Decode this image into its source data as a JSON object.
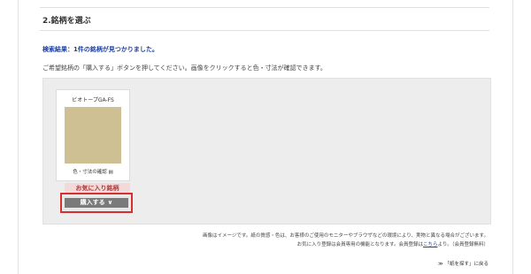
{
  "section": {
    "title": "2.銘柄を選ぶ"
  },
  "search": {
    "result": "検索結果：1件の銘柄が見つかりました。"
  },
  "instruction": "ご希望銘柄の「購入する」ボタンを押してください。画像をクリックすると色・寸法が確認できます。",
  "product": {
    "name": "ビオトープGA-FS",
    "swatch_color": "#cfc094",
    "details_link": "色・寸法の確認 ▤",
    "favorite_label": "お気に入り銘柄",
    "buy_label": "購入する",
    "buy_chevron": "∨",
    "highlight_color": "#d33131"
  },
  "notes": {
    "line1": "画像はイメージです。紙の質感・色は、お客様のご使用のモニターやブラウザなどの環境により、実物と異なる場合がございます。",
    "line2_before": "お気に入り登録は会員専用の機能となります。会員登録は",
    "line2_link": "こちら",
    "line2_after": "より。（会員登録無料）"
  },
  "back": {
    "label": "≫ 「紙を探す」に戻る"
  }
}
